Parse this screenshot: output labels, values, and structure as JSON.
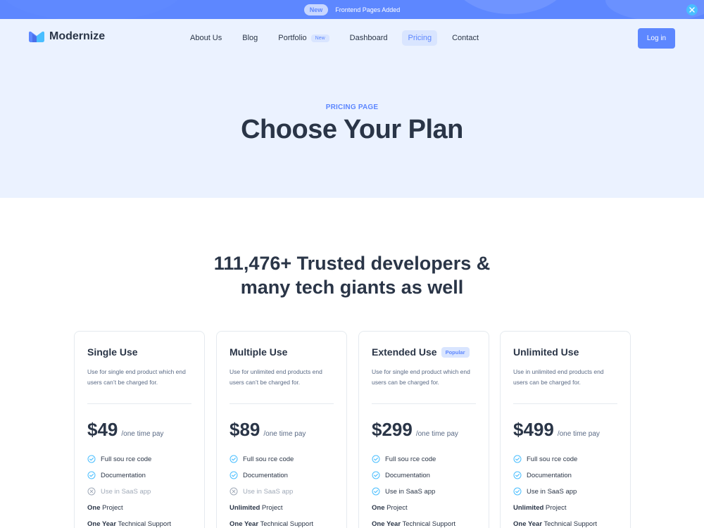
{
  "announcement": {
    "badge": "New",
    "text": "Frontend Pages Added"
  },
  "brand": {
    "name": "Modernize"
  },
  "nav": {
    "items": [
      {
        "label": "About Us"
      },
      {
        "label": "Blog"
      },
      {
        "label": "Portfolio",
        "badge": "New"
      },
      {
        "label": "Dashboard"
      },
      {
        "label": "Pricing",
        "active": true
      },
      {
        "label": "Contact"
      }
    ],
    "login_label": "Log in"
  },
  "hero": {
    "eyebrow": "PRICING PAGE",
    "title": "Choose Your Plan"
  },
  "trust": {
    "line1": "111,476+ Trusted developers &",
    "line2": "many tech giants as well"
  },
  "plans": [
    {
      "name": "Single Use",
      "badge": "",
      "description": "Use for single end product which end users can’t be charged for.",
      "price": "$49",
      "price_suffix": "/one time pay",
      "features": [
        {
          "label": "Full sou rce code",
          "included": true
        },
        {
          "label": "Documentation",
          "included": true
        },
        {
          "label": "Use in SaaS app",
          "included": false
        }
      ],
      "project_bold": "One",
      "project_rest": " Project",
      "support_bold": "One Year",
      "support_rest": " Technical Support"
    },
    {
      "name": "Multiple Use",
      "badge": "",
      "description": "Use for unlimited end products end users can’t be charged for.",
      "price": "$89",
      "price_suffix": "/one time pay",
      "features": [
        {
          "label": "Full sou rce code",
          "included": true
        },
        {
          "label": "Documentation",
          "included": true
        },
        {
          "label": "Use in SaaS app",
          "included": false
        }
      ],
      "project_bold": "Unlimited",
      "project_rest": " Project",
      "support_bold": "One Year",
      "support_rest": " Technical Support"
    },
    {
      "name": "Extended Use",
      "badge": "Popular",
      "description": "Use for single end product which end users can be charged for.",
      "price": "$299",
      "price_suffix": "/one time pay",
      "features": [
        {
          "label": "Full sou rce code",
          "included": true
        },
        {
          "label": "Documentation",
          "included": true
        },
        {
          "label": "Use in SaaS app",
          "included": true
        }
      ],
      "project_bold": "One",
      "project_rest": " Project",
      "support_bold": "One Year",
      "support_rest": " Technical Support"
    },
    {
      "name": "Unlimited Use",
      "badge": "",
      "description": "Use in unlimited end products end users can be charged for.",
      "price": "$499",
      "price_suffix": "/one time pay",
      "features": [
        {
          "label": "Full sou rce code",
          "included": true
        },
        {
          "label": "Documentation",
          "included": true
        },
        {
          "label": "Use in SaaS app",
          "included": true
        }
      ],
      "project_bold": "Unlimited",
      "project_rest": " Project",
      "support_bold": "One Year",
      "support_rest": " Technical Support"
    }
  ],
  "colors": {
    "primary": "#5d87ff",
    "accent": "#49beff",
    "hero_bg": "#ebf2ff",
    "text": "#2a3547",
    "muted": "#a0aab8"
  }
}
